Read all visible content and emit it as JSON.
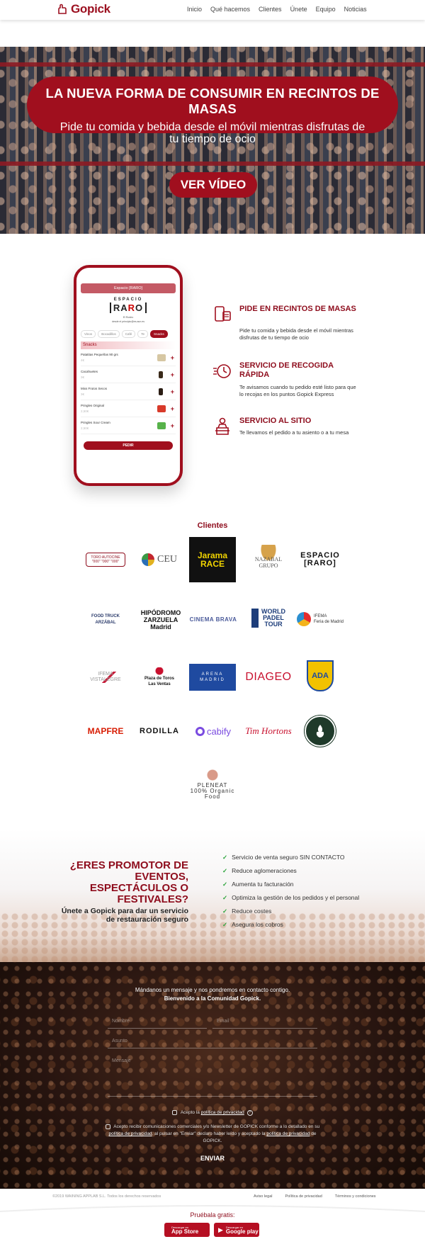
{
  "nav": {
    "brand": "Gopick",
    "items": [
      "Inicio",
      "Qué hacemos",
      "Clientes",
      "Únete",
      "Equipo",
      "Noticias"
    ]
  },
  "hero": {
    "title": "LA NUEVA FORMA DE CONSUMIR EN RECINTOS DE MASAS",
    "subtitle": "Pide tu comida y bebida desde el móvil mientras disfrutas de tu tiempo de ocio",
    "video_button": "VER VÍDEO"
  },
  "phone": {
    "header": "Espacio [RARO]",
    "logo_top": "ESPACIO",
    "logo_main_left": "RA",
    "logo_main_r": "R",
    "logo_main_right": "O",
    "address": "El Rodeo",
    "address2": "desde el principio@es.aun.es",
    "tabs": [
      "Vinos",
      "Bocadillos",
      "Café",
      "Te",
      "Snacks"
    ],
    "category": "Snacks",
    "items": [
      {
        "name": "Patatitas Pequeñas 90 grs",
        "price": "4€"
      },
      {
        "name": "Cacahuetes",
        "price": "3€"
      },
      {
        "name": "Mixs Frutos Secos",
        "price": "3€"
      },
      {
        "name": "Pringles Original",
        "price": "2,50€"
      },
      {
        "name": "Pringles Sour Cream",
        "price": "2,50€"
      }
    ],
    "order_button": "PEDIR"
  },
  "features": [
    {
      "title": "PIDE EN RECINTOS DE MASAS",
      "desc": "Pide tu comida y bebida desde el móvil mientras disfrutas de tu tiempo de ocio",
      "icon": "phone-order-icon"
    },
    {
      "title": "SERVICIO DE RECOGIDA RÁPIDA",
      "desc": "Te avisamos cuando tu pedido esté listo para que lo recojas en los puntos Gopick Express",
      "icon": "fast-pickup-icon"
    },
    {
      "title": "SERVICIO AL SITIO",
      "desc": "Te llevamos el pedido a tu asiento o a tu mesa",
      "icon": "seat-delivery-icon"
    }
  ],
  "clients": {
    "title": "Clientes",
    "logos": [
      {
        "name": "Toros Autocine",
        "text": "TORO AUTOCINE\n\"000\" \"000\" \"000\""
      },
      {
        "name": "CEU",
        "text": "CEU"
      },
      {
        "name": "Jarama Race",
        "text": "Jarama\nRACE"
      },
      {
        "name": "Nazabal Grupo",
        "text": "NAZABAL\nGRUPO"
      },
      {
        "name": "Espacio Raro",
        "text": "ESPACIO\n[RARO]"
      },
      {
        "name": "Food Truck Arzábal",
        "text": "FOOD TRUCK\nARZÁBAL"
      },
      {
        "name": "Hipódromo de la Zarzuela",
        "text": "HIPÓDROMO\nZARZUELA\nMadrid"
      },
      {
        "name": "Cinema Brava",
        "text": "CINEMA BRAVA"
      },
      {
        "name": "World Padel Tour",
        "text": "WORLD\nPADEL\nTOUR"
      },
      {
        "name": "IFEMA Feria de Madrid",
        "text": "IFEMA\nFeria de Madrid"
      },
      {
        "name": "IFEMA Palacio Vistalegre",
        "text": "IFEMA\nVISTALEGRE"
      },
      {
        "name": "Plaza de Toros Las Ventas",
        "text": "Plaza de Toros\nLas Ventas"
      },
      {
        "name": "Arena Madrid",
        "text": "ARENA\nMADRID"
      },
      {
        "name": "Diageo",
        "text": "DIAGEO"
      },
      {
        "name": "ADA",
        "text": "ADA"
      },
      {
        "name": "Mapfre",
        "text": "MAPFRE"
      },
      {
        "name": "Rodilla",
        "text": "RODILLA"
      },
      {
        "name": "Cabify",
        "text": "cabify"
      },
      {
        "name": "Tim Hortons",
        "text": "Tim Hortons"
      },
      {
        "name": "Camp fire badge",
        "text": ""
      },
      {
        "name": "Pleneat",
        "text": "PLENEAT\n100% Organic Food"
      }
    ]
  },
  "promo": {
    "title": "¿ERES PROMOTOR DE EVENTOS, ESPECTÁCULOS O FESTIVALES?",
    "subtitle": "Únete a Gopick para dar un servicio de restauración seguro",
    "benefits": [
      "Servicio de venta seguro SIN CONTACTO",
      "Reduce aglomeraciones",
      "Aumenta tu facturación",
      "Optimiza la gestión de los pedidos y el personal",
      "Reduce costes",
      "Asegura los cobros"
    ]
  },
  "contact": {
    "intro_line1": "Mándanos un mensaje y nos pondremos en contacto contigo.",
    "intro_line2": "Bienvenido a la Comunidad Gopick.",
    "name_placeholder": "Nombre",
    "email_placeholder": "Email",
    "subject_placeholder": "Asunto",
    "message_placeholder": "Mensaje",
    "privacy_prefix": "Acepto la",
    "privacy_link": "política de privacidad",
    "newsletter_text_1": "Acepto recibir comunicaciones comerciales y/o Newsletter de GOPICK conforme a lo detallado en su",
    "newsletter_link_1": "política de privacidad",
    "newsletter_text_2": ". al pulsar en \"Enviar\" declaro haber leído y aceptado la",
    "newsletter_link_2": "política de privacidad",
    "newsletter_text_3": "de GOPICK.",
    "send": "ENVIAR"
  },
  "footer": {
    "copyright": "©2019 WAINING APPLAB S.L. Todos los derechos reservados",
    "links": [
      "Aviso legal",
      "Política de privacidad",
      "Términos y condiciones"
    ],
    "try_label": "Pruébala gratis:",
    "app_store_small": "Descargar en",
    "app_store": "App Store",
    "google_small": "Descargar en",
    "google": "Google play"
  },
  "colors": {
    "brand": "#a00f1e",
    "brand_dark": "#8e0c1c",
    "check": "#2aa33a"
  }
}
